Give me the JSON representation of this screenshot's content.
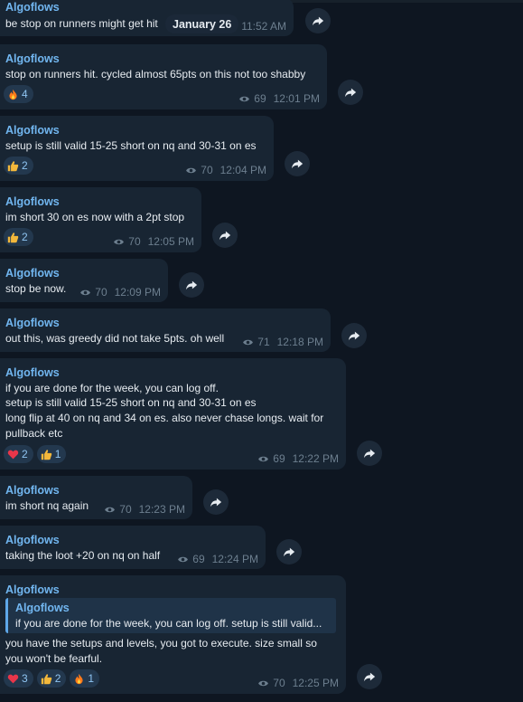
{
  "date_label": "January 26",
  "messages": [
    {
      "author": "Algoflows",
      "lines": [
        "be stop on runners might get hit"
      ],
      "views": "",
      "time": "11:52 AM",
      "reactions": []
    },
    {
      "author": "Algoflows",
      "lines": [
        "stop on runners hit. cycled almost 65pts on this not too shabby"
      ],
      "views": "69",
      "time": "12:01 PM",
      "reactions": [
        {
          "emoji": "fire",
          "count": "4"
        }
      ]
    },
    {
      "author": "Algoflows",
      "lines": [
        "setup is still valid 15-25 short on nq and 30-31 on es"
      ],
      "views": "70",
      "time": "12:04 PM",
      "reactions": [
        {
          "emoji": "thumbs-up",
          "count": "2"
        }
      ]
    },
    {
      "author": "Algoflows",
      "lines": [
        "im short 30 on es now with a 2pt stop"
      ],
      "views": "70",
      "time": "12:05 PM",
      "reactions": [
        {
          "emoji": "thumbs-up",
          "count": "2"
        }
      ]
    },
    {
      "author": "Algoflows",
      "lines": [
        "stop be now."
      ],
      "views": "70",
      "time": "12:09 PM",
      "reactions": []
    },
    {
      "author": "Algoflows",
      "lines": [
        "out this, was greedy did not take 5pts. oh well"
      ],
      "views": "71",
      "time": "12:18 PM",
      "reactions": []
    },
    {
      "author": "Algoflows",
      "lines": [
        "if you are done for the week, you can log off.",
        "setup is still valid 15-25 short on nq and 30-31 on es",
        "long flip at 40 on nq and 34 on es. also never chase longs. wait for",
        "pullback etc"
      ],
      "views": "69",
      "time": "12:22 PM",
      "reactions": [
        {
          "emoji": "heart",
          "count": "2"
        },
        {
          "emoji": "thumbs-up",
          "count": "1"
        }
      ]
    },
    {
      "author": "Algoflows",
      "lines": [
        "im short nq again"
      ],
      "views": "70",
      "time": "12:23 PM",
      "reactions": []
    },
    {
      "author": "Algoflows",
      "lines": [
        "taking the loot +20 on nq on half"
      ],
      "views": "69",
      "time": "12:24 PM",
      "reactions": []
    },
    {
      "author": "Algoflows",
      "quote": {
        "author": "Algoflows",
        "text": "if you are done for the week, you can log off. setup is still valid..."
      },
      "lines": [
        "you have the setups and levels,  you got to execute. size small so",
        "you won't be fearful."
      ],
      "views": "70",
      "time": "12:25 PM",
      "reactions": [
        {
          "emoji": "heart",
          "count": "3"
        },
        {
          "emoji": "thumbs-up",
          "count": "2"
        },
        {
          "emoji": "fire",
          "count": "1"
        }
      ]
    }
  ]
}
